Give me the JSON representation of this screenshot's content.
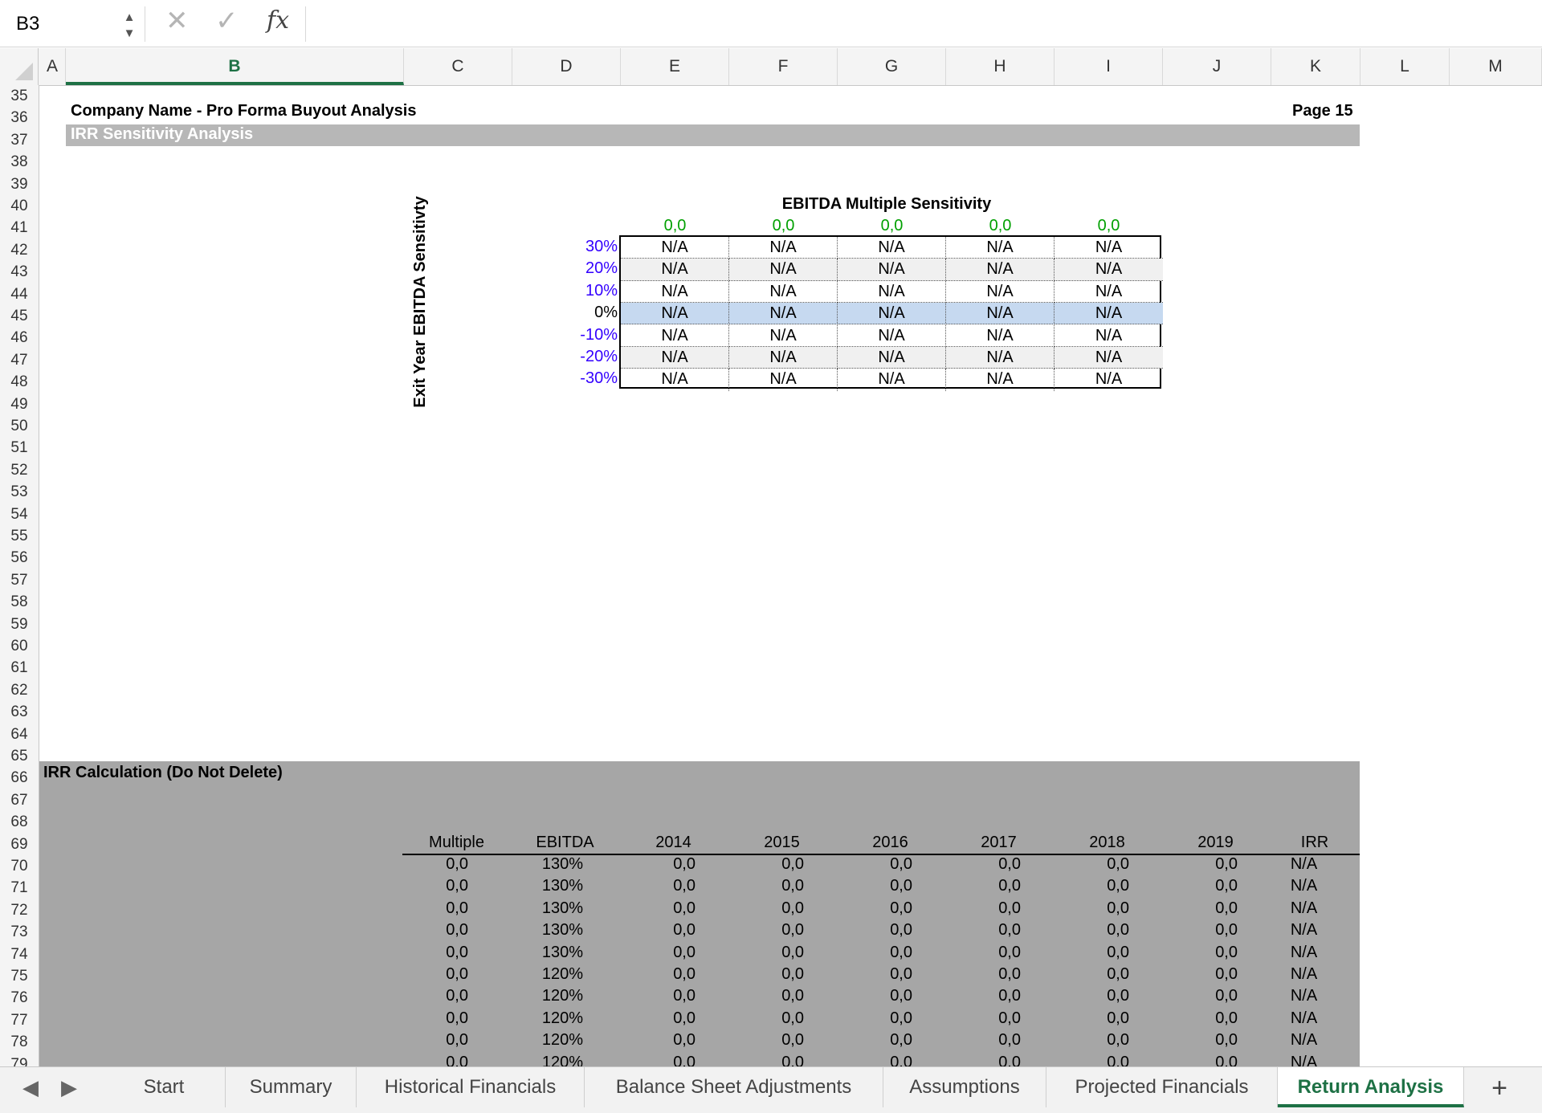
{
  "formula_bar": {
    "name_box": "B3",
    "cancel_icon": "✕",
    "confirm_icon": "✓",
    "fx_label": "fx"
  },
  "columns": [
    "A",
    "B",
    "C",
    "D",
    "E",
    "F",
    "G",
    "H",
    "I",
    "J",
    "K",
    "L",
    "M"
  ],
  "selected_column": "B",
  "rows": [
    "35",
    "36",
    "37",
    "38",
    "39",
    "40",
    "41",
    "42",
    "43",
    "44",
    "45",
    "46",
    "47",
    "48",
    "49",
    "50",
    "51",
    "52",
    "53",
    "54",
    "55",
    "56",
    "57",
    "58",
    "59",
    "60",
    "61",
    "62",
    "63",
    "64",
    "65",
    "66",
    "67",
    "68",
    "69",
    "70",
    "71",
    "72",
    "73",
    "74",
    "75",
    "76",
    "77",
    "78",
    "79"
  ],
  "sheet": {
    "title": "Company Name - Pro Forma Buyout Analysis",
    "page": "Page 15",
    "subtitle": "IRR Sensitivity Analysis",
    "sensitivity": {
      "title": "EBITDA Multiple Sensitivity",
      "axis_label": "Exit Year EBITDA Sensitivty",
      "multiples": [
        "0,0",
        "0,0",
        "0,0",
        "0,0",
        "0,0"
      ],
      "rows": [
        {
          "pct": "30%",
          "values": [
            "N/A",
            "N/A",
            "N/A",
            "N/A",
            "N/A"
          ]
        },
        {
          "pct": "20%",
          "values": [
            "N/A",
            "N/A",
            "N/A",
            "N/A",
            "N/A"
          ]
        },
        {
          "pct": "10%",
          "values": [
            "N/A",
            "N/A",
            "N/A",
            "N/A",
            "N/A"
          ]
        },
        {
          "pct": "0%",
          "values": [
            "N/A",
            "N/A",
            "N/A",
            "N/A",
            "N/A"
          ]
        },
        {
          "pct": "-10%",
          "values": [
            "N/A",
            "N/A",
            "N/A",
            "N/A",
            "N/A"
          ]
        },
        {
          "pct": "-20%",
          "values": [
            "N/A",
            "N/A",
            "N/A",
            "N/A",
            "N/A"
          ]
        },
        {
          "pct": "-30%",
          "values": [
            "N/A",
            "N/A",
            "N/A",
            "N/A",
            "N/A"
          ]
        }
      ]
    },
    "irr_calc": {
      "title": "IRR Calculation (Do Not Delete)",
      "headers": [
        "Multiple",
        "EBITDA",
        "2014",
        "2015",
        "2016",
        "2017",
        "2018",
        "2019",
        "IRR"
      ],
      "rows": [
        [
          "0,0",
          "130%",
          "0,0",
          "0,0",
          "0,0",
          "0,0",
          "0,0",
          "0,0",
          "N/A"
        ],
        [
          "0,0",
          "130%",
          "0,0",
          "0,0",
          "0,0",
          "0,0",
          "0,0",
          "0,0",
          "N/A"
        ],
        [
          "0,0",
          "130%",
          "0,0",
          "0,0",
          "0,0",
          "0,0",
          "0,0",
          "0,0",
          "N/A"
        ],
        [
          "0,0",
          "130%",
          "0,0",
          "0,0",
          "0,0",
          "0,0",
          "0,0",
          "0,0",
          "N/A"
        ],
        [
          "0,0",
          "130%",
          "0,0",
          "0,0",
          "0,0",
          "0,0",
          "0,0",
          "0,0",
          "N/A"
        ],
        [
          "0,0",
          "120%",
          "0,0",
          "0,0",
          "0,0",
          "0,0",
          "0,0",
          "0,0",
          "N/A"
        ],
        [
          "0,0",
          "120%",
          "0,0",
          "0,0",
          "0,0",
          "0,0",
          "0,0",
          "0,0",
          "N/A"
        ],
        [
          "0,0",
          "120%",
          "0,0",
          "0,0",
          "0,0",
          "0,0",
          "0,0",
          "0,0",
          "N/A"
        ],
        [
          "0,0",
          "120%",
          "0,0",
          "0,0",
          "0,0",
          "0,0",
          "0,0",
          "0,0",
          "N/A"
        ],
        [
          "0,0",
          "120%",
          "0,0",
          "0,0",
          "0,0",
          "0,0",
          "0,0",
          "0,0",
          "N/A"
        ]
      ]
    }
  },
  "tabs": [
    "Start",
    "Summary",
    "Historical Financials",
    "Balance Sheet Adjustments",
    "Assumptions",
    "Projected Financials",
    "Return Analysis"
  ],
  "active_tab": "Return Analysis",
  "add_sheet_label": "+",
  "colors": {
    "accent": "#1e7145",
    "percent_blue": "#3300ff",
    "multiple_green": "#00a000",
    "highlight": "#c6d9f0"
  }
}
